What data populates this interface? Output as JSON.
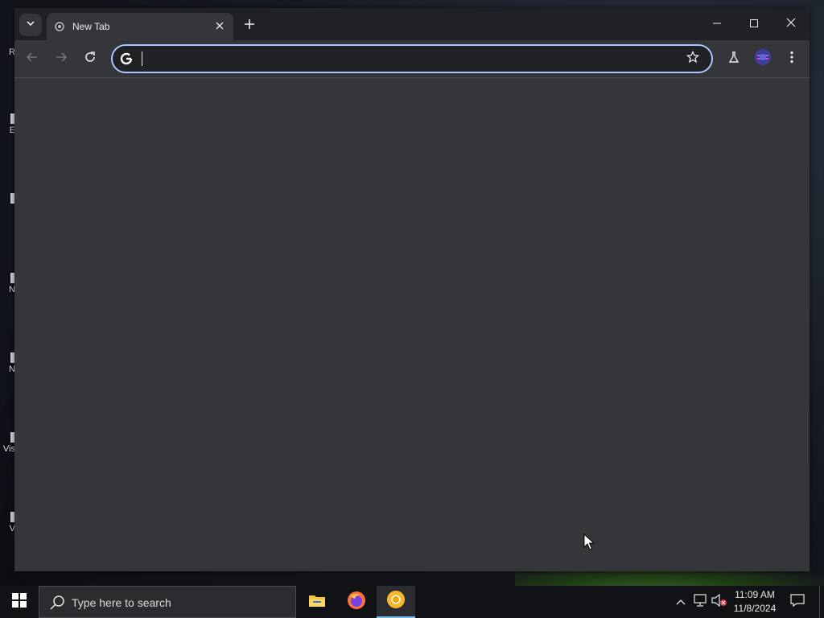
{
  "desktop": {
    "icons": [
      {
        "label": "R",
        "icon": "desktop-shortcut-icon"
      },
      {
        "label": "E",
        "icon": "desktop-shortcut-icon"
      },
      {
        "label": "",
        "icon": "desktop-shortcut-icon"
      },
      {
        "label": "N",
        "icon": "desktop-shortcut-icon"
      },
      {
        "label": "N",
        "icon": "desktop-shortcut-icon"
      },
      {
        "label": "Vis",
        "icon": "desktop-shortcut-icon"
      },
      {
        "label": "V",
        "icon": "desktop-shortcut-icon"
      }
    ]
  },
  "browser": {
    "tab": {
      "title": "New Tab",
      "favicon": "chrome-icon"
    },
    "omnibox": {
      "value": "",
      "placeholder": ""
    },
    "colors": {
      "omnibox_focus": "#a8c7fa",
      "toolbar": "#35363a",
      "frame": "#202124"
    }
  },
  "taskbar": {
    "search_placeholder": "Type here to search",
    "apps": [
      {
        "name": "File Explorer",
        "icon": "folder-icon"
      },
      {
        "name": "Firefox",
        "icon": "firefox-icon"
      },
      {
        "name": "Chrome Canary",
        "icon": "chrome-canary-icon",
        "active": true
      }
    ],
    "clock": {
      "time": "11:09 AM",
      "date": "11/8/2024"
    }
  }
}
